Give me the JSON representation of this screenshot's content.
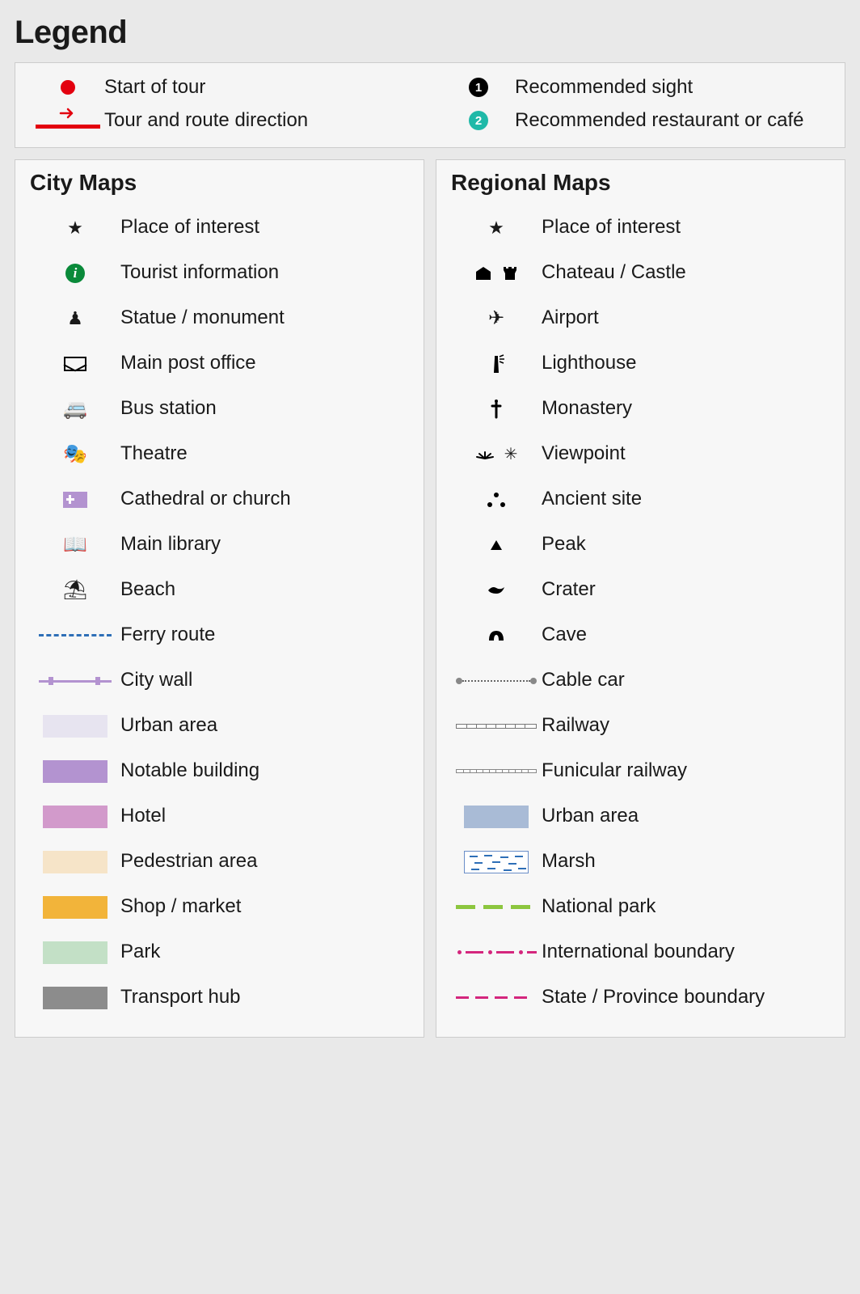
{
  "title": "Legend",
  "top": {
    "start_of_tour": "Start of tour",
    "tour_direction": "Tour and route direction",
    "recommended_sight": "Recommended sight",
    "recommended_sight_num": "1",
    "recommended_restaurant": "Recommended restaurant or café",
    "recommended_restaurant_num": "2"
  },
  "city": {
    "heading": "City Maps",
    "items": [
      {
        "icon": "star",
        "label": "Place of interest"
      },
      {
        "icon": "info",
        "label": "Tourist information"
      },
      {
        "icon": "statue",
        "label": "Statue / monument"
      },
      {
        "icon": "post",
        "label": "Main post office"
      },
      {
        "icon": "bus",
        "label": "Bus station"
      },
      {
        "icon": "theatre",
        "label": "Theatre"
      },
      {
        "icon": "church",
        "label": "Cathedral or church"
      },
      {
        "icon": "library",
        "label": "Main library"
      },
      {
        "icon": "beach",
        "label": "Beach"
      },
      {
        "icon": "ferry",
        "label": "Ferry route"
      },
      {
        "icon": "citywall",
        "label": "City wall"
      },
      {
        "icon": "sw-urban-city",
        "label": "Urban area"
      },
      {
        "icon": "sw-notable",
        "label": "Notable building"
      },
      {
        "icon": "sw-hotel",
        "label": "Hotel"
      },
      {
        "icon": "sw-ped",
        "label": "Pedestrian area"
      },
      {
        "icon": "sw-shop",
        "label": "Shop / market"
      },
      {
        "icon": "sw-park",
        "label": "Park"
      },
      {
        "icon": "sw-transport",
        "label": "Transport hub"
      }
    ]
  },
  "regional": {
    "heading": "Regional Maps",
    "items": [
      {
        "icon": "star",
        "label": "Place of interest"
      },
      {
        "icon": "castle",
        "label": "Chateau / Castle"
      },
      {
        "icon": "airport",
        "label": "Airport"
      },
      {
        "icon": "lighthouse",
        "label": "Lighthouse"
      },
      {
        "icon": "monastery",
        "label": "Monastery"
      },
      {
        "icon": "viewpoint",
        "label": "Viewpoint"
      },
      {
        "icon": "ancient",
        "label": "Ancient site"
      },
      {
        "icon": "peak",
        "label": "Peak"
      },
      {
        "icon": "crater",
        "label": "Crater"
      },
      {
        "icon": "cave",
        "label": "Cave"
      },
      {
        "icon": "cablecar",
        "label": "Cable car"
      },
      {
        "icon": "railway",
        "label": "Railway"
      },
      {
        "icon": "funicular",
        "label": "Funicular railway"
      },
      {
        "icon": "sw-urban-reg",
        "label": "Urban area"
      },
      {
        "icon": "marsh",
        "label": "Marsh"
      },
      {
        "icon": "natpark",
        "label": "National park"
      },
      {
        "icon": "intl",
        "label": "International boundary"
      },
      {
        "icon": "state",
        "label": "State / Province boundary"
      }
    ]
  },
  "colors": {
    "tour_red": "#e3000f",
    "info_green": "#0a8a3a",
    "church_purple": "#b393d0",
    "teal": "#1fb9a8",
    "magenta": "#d4267d",
    "natpark_green": "#8cc63f",
    "ferry_blue": "#2e6fb7",
    "urban_region_blue": "#a9bbd6"
  }
}
